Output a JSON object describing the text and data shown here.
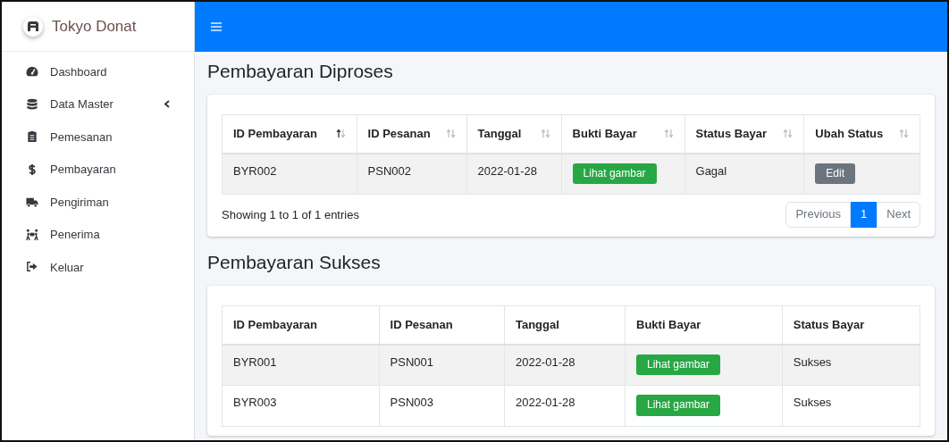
{
  "sidebar": {
    "brand": "Tokyo Donat",
    "items": [
      {
        "label": "Dashboard",
        "submenu": false
      },
      {
        "label": "Data Master",
        "submenu": true
      },
      {
        "label": "Pemesanan",
        "submenu": false
      },
      {
        "label": "Pembayaran",
        "submenu": false
      },
      {
        "label": "Pengiriman",
        "submenu": false
      },
      {
        "label": "Penerima",
        "submenu": false
      },
      {
        "label": "Keluar",
        "submenu": false
      }
    ]
  },
  "sections": [
    {
      "title": "Pembayaran Diproses",
      "table": {
        "columns": [
          {
            "label": "ID Pembayaran",
            "kind": "text",
            "sorted": true
          },
          {
            "label": "ID Pesanan",
            "kind": "text",
            "sorted": false
          },
          {
            "label": "Tanggal",
            "kind": "text",
            "sorted": false
          },
          {
            "label": "Bukti Bayar",
            "kind": "view-button",
            "sorted": false
          },
          {
            "label": "Status Bayar",
            "kind": "text",
            "sorted": false
          },
          {
            "label": "Ubah Status",
            "kind": "edit-button",
            "sorted": false
          }
        ],
        "rows": [
          [
            "BYR002",
            "PSN002",
            "2022-01-28",
            "Lihat gambar",
            "Gagal",
            "Edit"
          ]
        ]
      },
      "info": "Showing 1 to 1 of 1 entries",
      "pagination": {
        "previous": "Previous",
        "pages": [
          {
            "label": "1",
            "selected": true
          }
        ],
        "next": "Next"
      }
    },
    {
      "title": "Pembayaran Sukses",
      "table": {
        "columns": [
          {
            "label": "ID Pembayaran",
            "kind": "text"
          },
          {
            "label": "ID Pesanan",
            "kind": "text"
          },
          {
            "label": "Tanggal",
            "kind": "text"
          },
          {
            "label": "Bukti Bayar",
            "kind": "view-button"
          },
          {
            "label": "Status Bayar",
            "kind": "text"
          }
        ],
        "rows": [
          [
            "BYR001",
            "PSN001",
            "2022-01-28",
            "Lihat gambar",
            "Sukses"
          ],
          [
            "BYR003",
            "PSN003",
            "2022-01-28",
            "Lihat gambar",
            "Sukses"
          ]
        ]
      }
    }
  ]
}
